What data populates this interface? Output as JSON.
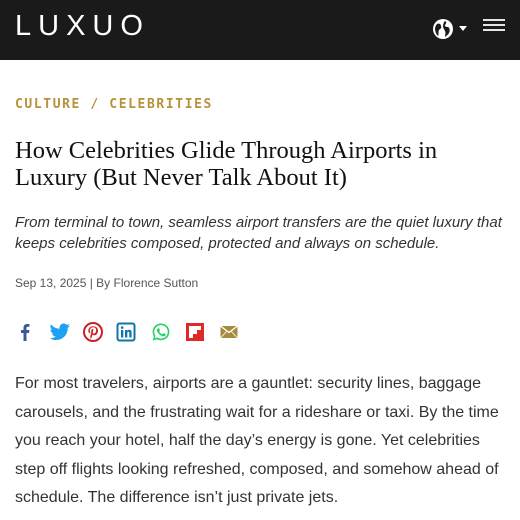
{
  "header": {
    "logo": "LUXUO",
    "language_icon": "globe-icon",
    "menu_icon": "hamburger-menu-icon",
    "background_color": "#1a1a1a"
  },
  "article": {
    "category_primary": "CULTURE",
    "category_separator": " / ",
    "category_secondary": "CELEBRITIES",
    "category_color": "#b8913a",
    "title": "How Celebrities Glide Through Airports in Luxury (But Never Talk About It)",
    "standfirst": "From terminal to town, seamless airport transfers are the quiet luxury that keeps celebrities composed, protected and always on schedule.",
    "meta": "Sep 13, 2025 | By Florence Sutton",
    "share_icons": [
      "facebook-icon",
      "twitter-icon",
      "pinterest-icon",
      "linkedin-icon",
      "whatsapp-icon",
      "flipboard-icon",
      "email-icon"
    ],
    "body": "For most travelers, airports are a gauntlet: security lines, baggage carousels, and the frustrating wait for a rideshare or taxi. By the time you reach your hotel, half the day’s energy is gone. Yet celebrities step off flights looking refreshed, composed, and somehow ahead of schedule. The difference isn’t just private jets."
  }
}
